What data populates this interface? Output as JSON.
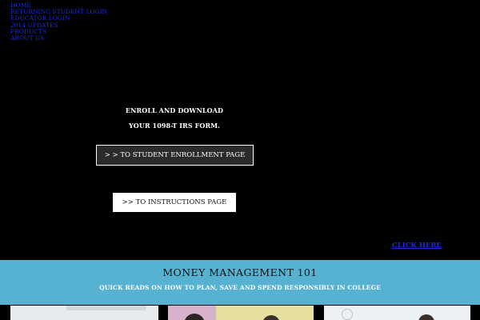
{
  "nav": {
    "items": [
      {
        "label": "HOME"
      },
      {
        "label": "RETURNING STUDENT LOGIN"
      },
      {
        "label": "EDUCATOR LOGIN"
      },
      {
        "label": "2014 UPDATES"
      },
      {
        "label": "PRODUCTS"
      },
      {
        "label": "ABOUT US"
      }
    ]
  },
  "hero": {
    "line1": "ENROLL AND DOWNLOAD",
    "line2": "YOUR 1098-T IRS FORM.",
    "enroll_button": "> > TO STUDENT ENROLLMENT PAGE",
    "instructions_button": ">> TO INSTRUCTIONS PAGE",
    "click_here": "CLICK HERE"
  },
  "banner": {
    "title": "MONEY MANAGEMENT 101",
    "subtitle": "QUICK READS ON HOW TO PLAN, SAVE AND SPEND RESPONSIBLY IN COLLEGE"
  },
  "colors": {
    "background": "#000000",
    "link": "#1a2dd6",
    "banner": "#57b1d1"
  }
}
